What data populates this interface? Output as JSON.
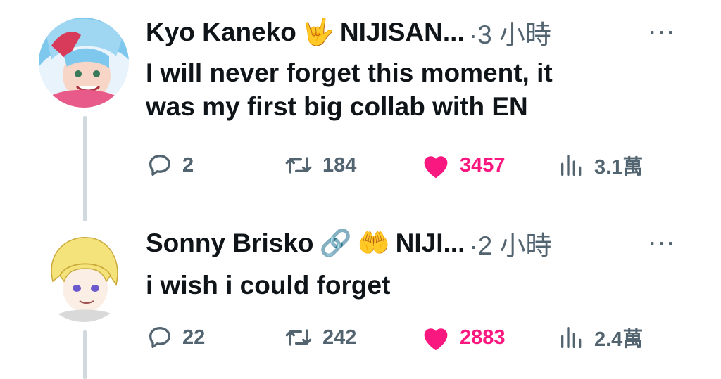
{
  "tweets": [
    {
      "name": "Kyo Kaneko",
      "emojis": [
        "🤟"
      ],
      "handle": "NIJISAN...",
      "time": "·3 小時",
      "more": "···",
      "lines": [
        "I will never forget this moment, it",
        "was my first big collab with EN"
      ],
      "replies": "2",
      "retweets": "184",
      "likes": "3457",
      "views": "3.1萬"
    },
    {
      "name": "Sonny Brisko",
      "emojis": [
        "🔗",
        "🤲"
      ],
      "handle": "NIJI...",
      "time": "·2 小時",
      "more": "···",
      "lines": [
        "i wish i could forget"
      ],
      "replies": "22",
      "retweets": "242",
      "likes": "2883",
      "views": "2.4萬"
    }
  ],
  "colors": {
    "accent_like": "#f91880",
    "muted": "#536471",
    "text": "#0f1419",
    "thread_line": "#cfd9de"
  },
  "icons": [
    "reply-icon",
    "retweet-icon",
    "like-icon",
    "views-icon",
    "more-icon"
  ]
}
